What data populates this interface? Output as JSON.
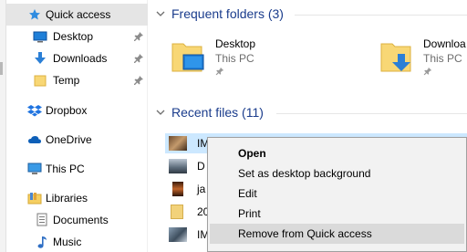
{
  "sidebar": {
    "items": [
      {
        "label": "Quick access",
        "icon": "star-icon"
      },
      {
        "label": "Desktop",
        "icon": "desktop-icon"
      },
      {
        "label": "Downloads",
        "icon": "download-arrow-icon"
      },
      {
        "label": "Temp",
        "icon": "folder-icon"
      },
      {
        "label": "Dropbox",
        "icon": "dropbox-icon"
      },
      {
        "label": "OneDrive",
        "icon": "cloud-icon"
      },
      {
        "label": "This PC",
        "icon": "computer-icon"
      },
      {
        "label": "Libraries",
        "icon": "libraries-icon"
      },
      {
        "label": "Documents",
        "icon": "documents-icon"
      },
      {
        "label": "Music",
        "icon": "music-icon"
      }
    ]
  },
  "frequent": {
    "title": "Frequent folders (3)",
    "folders": [
      {
        "name": "Desktop",
        "location": "This PC"
      },
      {
        "name": "Downloa",
        "location": "This PC"
      }
    ]
  },
  "recent": {
    "title": "Recent files (11)",
    "files": [
      {
        "name": "IM"
      },
      {
        "name": "D"
      },
      {
        "name": "ja"
      },
      {
        "name": "20"
      },
      {
        "name": "IM"
      }
    ]
  },
  "context_menu": {
    "items": [
      "Open",
      "Set as desktop background",
      "Edit",
      "Print",
      "Remove from Quick access"
    ]
  },
  "colors": {
    "selection": "#e5e5e5",
    "file_highlight": "#cce8ff",
    "header_text": "#1a3c8c",
    "menu_hover": "#dadada"
  }
}
